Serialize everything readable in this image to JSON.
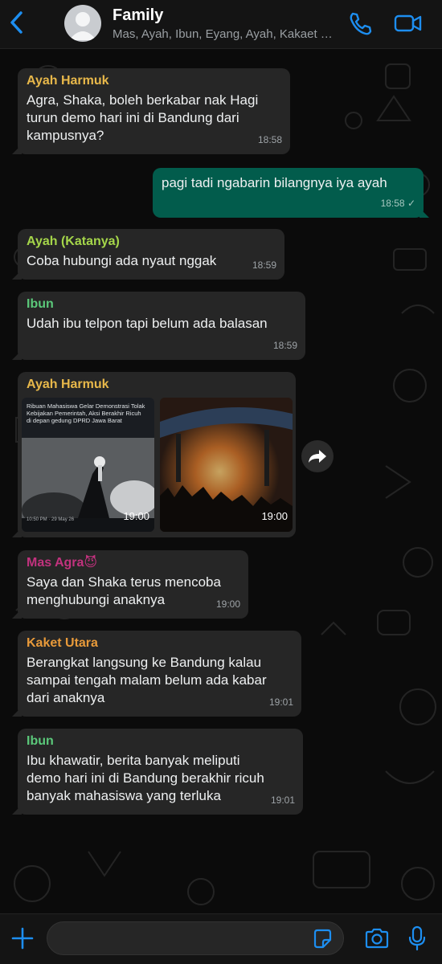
{
  "header": {
    "title": "Family",
    "subtitle": "Mas, Ayah, Ibun, Eyang, Ayah, Kakaet Utara, ..."
  },
  "messages": [
    {
      "sender": "Ayah Harmuk",
      "sender_color": "#e8b84a",
      "text": "Agra, Shaka, boleh berkabar nak Hagi\nturun demo hari ini di Bandung dari\nkampusnya?",
      "time": "18:58"
    },
    {
      "text": "pagi tadi ngabarin bilangnya iya ayah",
      "time": "18:58 ✓"
    },
    {
      "sender": "Ayah (Katanya)",
      "sender_color": "#a5d64a",
      "text": "Coba hubungi ada nyaut nggak",
      "time": "18:59"
    },
    {
      "sender": "Ibun",
      "sender_color": "#5bc87a",
      "text": "Udah ibu telpon tapi belum ada balasan",
      "time": "18:59"
    },
    {
      "sender": "Ayah Harmuk",
      "sender_color": "#e8b84a",
      "photo1_caption": "Ribuan Mahasiswa Gelar Demonstrasi Tolak Kebijakan Pemerintah, Aksi Berakhir Ricuh di depan gedung DPRD Jawa Barat",
      "photo1_stamp": "10:50 PM · 29 May 26",
      "photo1_time": "19:00",
      "photo2_time": "19:00"
    },
    {
      "sender": "Mas Agra😈",
      "sender_color": "#c2327e",
      "text": "Saya dan Shaka terus mencoba\nmenghubungi anaknya",
      "time": "19:00"
    },
    {
      "sender": "Kaket Utara",
      "sender_color": "#e89a3a",
      "text": "Berangkat langsung ke Bandung kalau\nsampai tengah malam belum ada kabar\ndari anaknya",
      "time": "19:01"
    },
    {
      "sender": "Ibun",
      "sender_color": "#5bc87a",
      "text": "Ibu khawatir, berita banyak meliputi\ndemo hari ini di Bandung berakhir ricuh\nbanyak mahasiswa yang terluka",
      "time": "19:01"
    }
  ],
  "colors": {
    "accent": "#1d8ef0",
    "outgoing_bubble": "#025c4c",
    "incoming_bubble": "#262626"
  },
  "icons": [
    "back-icon",
    "avatar",
    "call-icon",
    "video-icon",
    "forward-icon",
    "plus-icon",
    "sticker-icon",
    "camera-icon",
    "mic-icon"
  ]
}
